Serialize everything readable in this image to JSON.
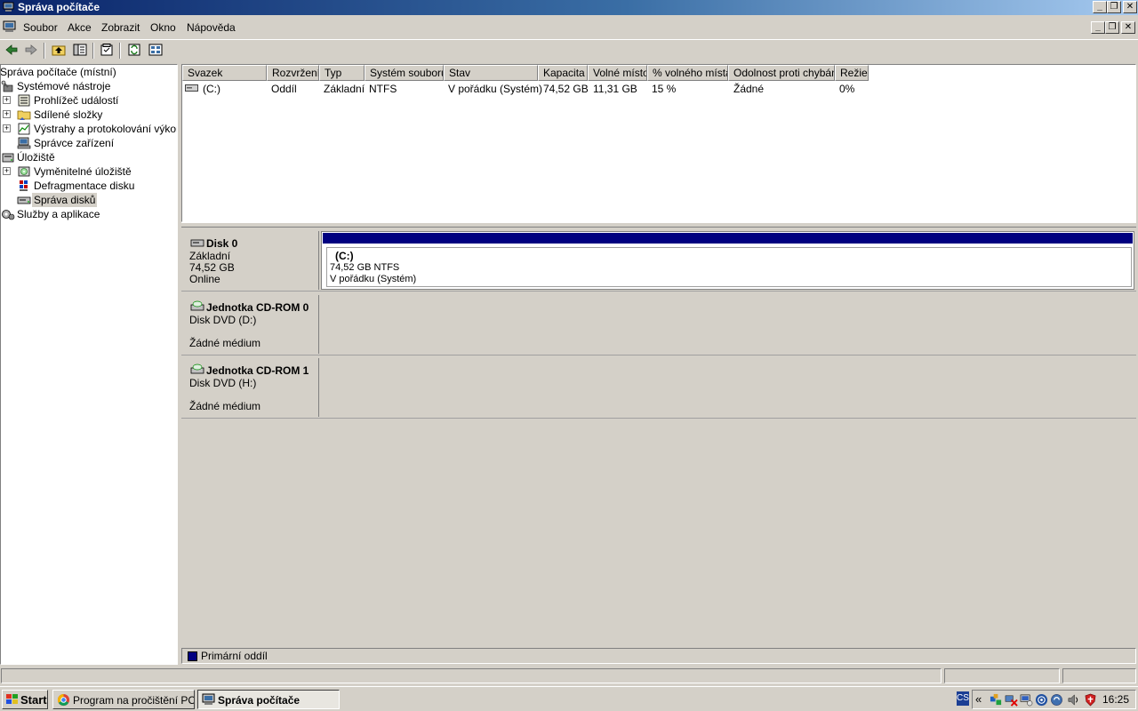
{
  "window": {
    "title": "Správa počítače"
  },
  "menu": [
    "Soubor",
    "Akce",
    "Zobrazit",
    "Okno",
    "Nápověda"
  ],
  "tree": {
    "root": "Správa počítače (místní)",
    "system_tools": "Systémové nástroje",
    "event_viewer": "Prohlížeč událostí",
    "shared_folders": "Sdílené složky",
    "perf_logs": "Výstrahy a protokolování výkonu",
    "device_manager": "Správce zařízení",
    "storage": "Úložiště",
    "removable": "Vyměnitelné úložiště",
    "defrag": "Defragmentace disku",
    "disk_mgmt": "Správa disků",
    "services": "Služby a aplikace"
  },
  "columns": [
    "Svazek",
    "Rozvržení",
    "Typ",
    "Systém souborů",
    "Stav",
    "Kapacita",
    "Volné místo",
    "% volného místa",
    "Odolnost proti chybám",
    "Režie"
  ],
  "volumes": [
    {
      "name": "(C:)",
      "layout": "Oddíl",
      "type": "Základní",
      "fs": "NTFS",
      "status": "V pořádku (Systém)",
      "capacity": "74,52 GB",
      "free": "11,31 GB",
      "pct_free": "15 %",
      "fault_tolerance": "Žádné",
      "overhead": "0%"
    }
  ],
  "disks": [
    {
      "name": "Disk 0",
      "line1": "Základní",
      "line2": "74,52 GB",
      "line3": "Online",
      "partition": {
        "name": "(C:)",
        "size_fs": "74,52 GB NTFS",
        "status": "V pořádku (Systém)"
      }
    },
    {
      "name": "Jednotka CD-ROM 0",
      "line1": "Disk DVD (D:)",
      "line3": "Žádné médium"
    },
    {
      "name": "Jednotka CD-ROM 1",
      "line1": "Disk DVD (H:)",
      "line3": "Žádné médium"
    }
  ],
  "legend": {
    "label": "Primární oddíl",
    "color": "#000080"
  },
  "taskbar": {
    "start": "Start",
    "tasks": [
      "Program na pročištění PC...",
      "Správa počítače"
    ],
    "lang": "CS",
    "chevron": "«",
    "clock": "16:25"
  },
  "icons": [
    "back-icon",
    "forward-icon",
    "up-icon",
    "show-tree-icon",
    "properties-icon",
    "refresh-icon",
    "help-icon"
  ]
}
